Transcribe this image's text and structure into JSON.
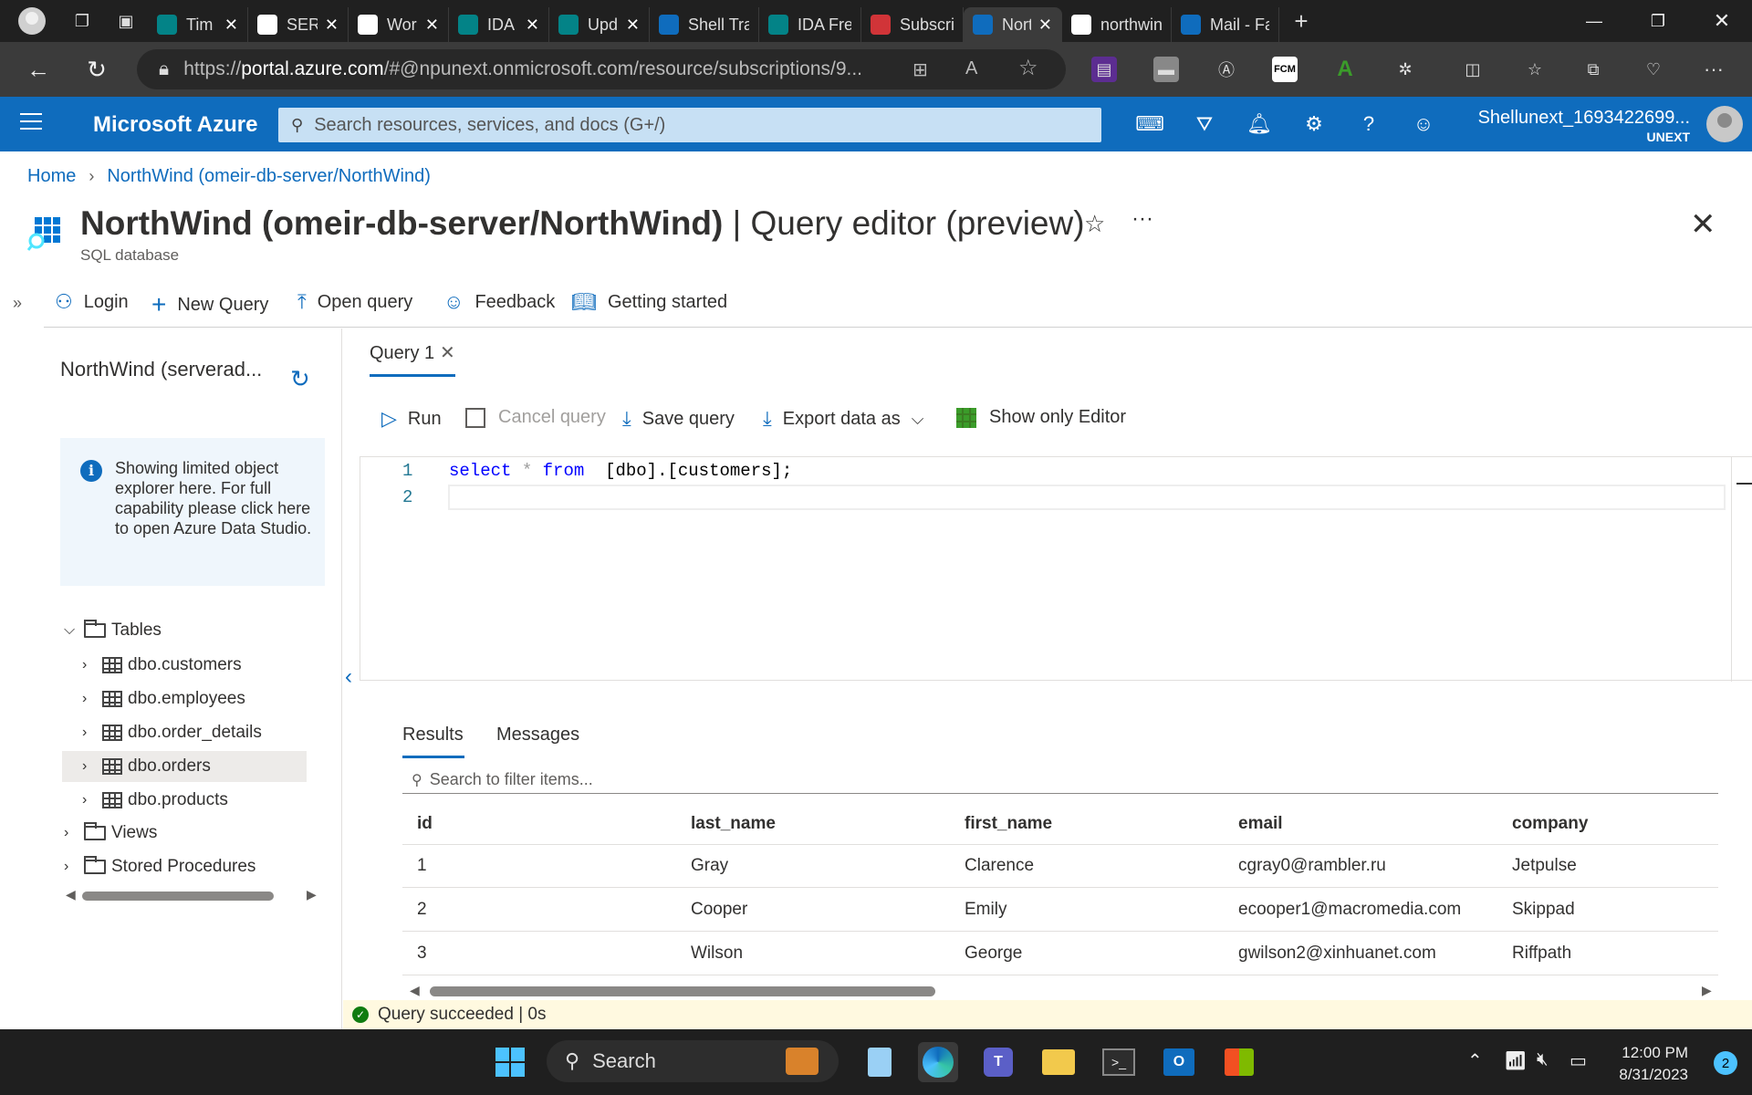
{
  "browser": {
    "tabs": [
      {
        "label": "Tim",
        "icon": "sharepoint-icon",
        "color": "#038387"
      },
      {
        "label": "SER",
        "icon": "document-icon",
        "color": "#ffffff"
      },
      {
        "label": "Wor",
        "icon": "edge-icon",
        "color": "#ffffff"
      },
      {
        "label": "IDA",
        "icon": "sharepoint-icon",
        "color": "#038387"
      },
      {
        "label": "Upd",
        "icon": "sharepoint-icon",
        "color": "#038387"
      },
      {
        "label": "Shell Trai",
        "icon": "onedrive-icon",
        "color": "#0f6cbd"
      },
      {
        "label": "IDA Fresl",
        "icon": "sharepoint-icon",
        "color": "#038387"
      },
      {
        "label": "Subscript",
        "icon": "arc-icon",
        "color": "#d13438"
      },
      {
        "label": "Nort",
        "icon": "azure-icon",
        "color": "#0f6cbd"
      },
      {
        "label": "northwin",
        "icon": "github-icon",
        "color": "#ffffff"
      },
      {
        "label": "Mail - Fa",
        "icon": "outlook-icon",
        "color": "#0f6cbd"
      }
    ],
    "url_host": "portal.azure.com",
    "url_scheme": "https://",
    "url_rest": "/#@npunext.onmicrosoft.com/resource/subscriptions/9..."
  },
  "azure": {
    "brand": "Microsoft Azure",
    "search_placeholder": "Search resources, services, and docs (G+/)",
    "account_name": "Shellunext_1693422699...",
    "account_tenant": "UNEXT"
  },
  "breadcrumb": {
    "home": "Home",
    "current": "NorthWind (omeir-db-server/NorthWind)"
  },
  "page": {
    "title_bold": "NorthWind (omeir-db-server/NorthWind)",
    "title_rest": " | Query editor (preview)",
    "subtitle": "SQL database",
    "more": "···"
  },
  "commands": {
    "login": "Login",
    "new_query": "New Query",
    "open_query": "Open query",
    "feedback": "Feedback",
    "getting_started": "Getting started"
  },
  "explorer": {
    "db_title": "NorthWind (serverad...",
    "info": "Showing limited object explorer here. For full capability please click here to open Azure Data Studio.",
    "tables_label": "Tables",
    "tables": [
      "dbo.customers",
      "dbo.employees",
      "dbo.order_details",
      "dbo.orders",
      "dbo.products"
    ],
    "selected_table": "dbo.orders",
    "views_label": "Views",
    "procs_label": "Stored Procedures"
  },
  "query": {
    "tab_label": "Query 1",
    "run": "Run",
    "cancel": "Cancel query",
    "save": "Save query",
    "export": "Export data as",
    "show_editor": "Show only Editor",
    "line_numbers": [
      "1",
      "2"
    ],
    "code_kw1": "select",
    "code_op": "*",
    "code_kw2": "from",
    "code_rest": "[dbo].[customers];"
  },
  "results": {
    "tab_results": "Results",
    "tab_messages": "Messages",
    "filter_placeholder": "Search to filter items...",
    "columns": [
      "id",
      "last_name",
      "first_name",
      "email",
      "company"
    ],
    "rows": [
      [
        "1",
        "Gray",
        "Clarence",
        "cgray0@rambler.ru",
        "Jetpulse"
      ],
      [
        "2",
        "Cooper",
        "Emily",
        "ecooper1@macromedia.com",
        "Skippad"
      ],
      [
        "3",
        "Wilson",
        "George",
        "gwilson2@xinhuanet.com",
        "Riffpath"
      ]
    ],
    "status": "Query succeeded | 0s"
  },
  "taskbar": {
    "search": "Search",
    "time": "12:00 PM",
    "date": "8/31/2023",
    "notifications": "2"
  },
  "colors": {
    "azure_blue": "#0f6cbd",
    "status_bg": "#fff9e0",
    "success": "#107c10"
  }
}
